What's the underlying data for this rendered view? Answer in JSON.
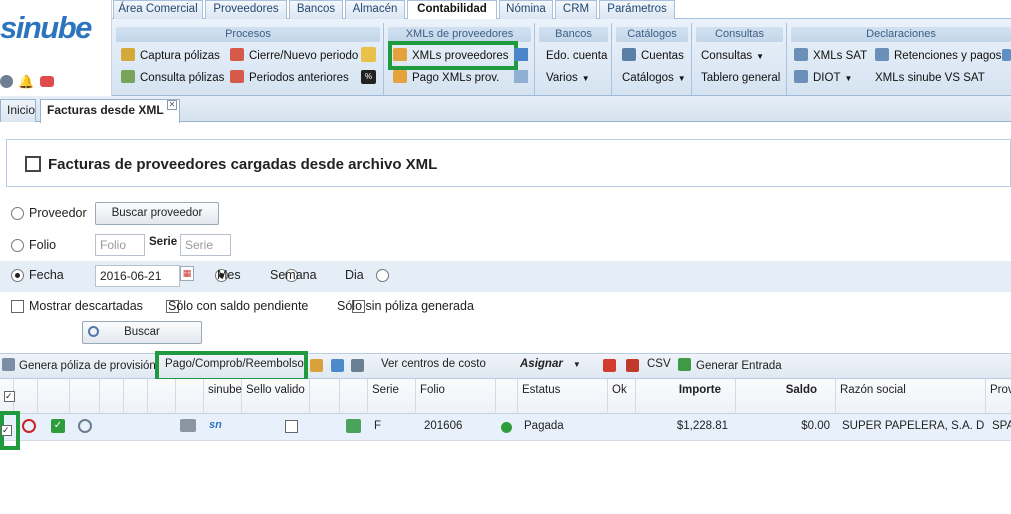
{
  "app": {
    "logo": "sinube"
  },
  "module_tabs": [
    "Área Comercial",
    "Proveedores",
    "Bancos",
    "Almacén",
    "Contabilidad",
    "Nómina",
    "CRM",
    "Parámetros"
  ],
  "active_module": "Contabilidad",
  "ribbon": {
    "procesos": {
      "title": "Procesos",
      "captura": "Captura pólizas",
      "consulta": "Consulta pólizas",
      "cierre": "Cierre/Nuevo periodo",
      "periodos": "Periodos anteriores"
    },
    "xmls": {
      "title": "XMLs de proveedores",
      "xmls_prov": "XMLs proveedores",
      "pago": "Pago XMLs prov."
    },
    "bancos": {
      "title": "Bancos",
      "edo": "Edo. cuenta",
      "varios": "Varios"
    },
    "catalogos": {
      "title": "Catálogos",
      "cuentas": "Cuentas",
      "catalogos": "Catálogos"
    },
    "consultas": {
      "title": "Consultas",
      "consultas": "Consultas",
      "tablero": "Tablero general"
    },
    "declaraciones": {
      "title": "Declaraciones",
      "xmls_sat": "XMLs SAT",
      "retenciones": "Retenciones y pagos",
      "diot": "DIOT",
      "xmls_vs": "XMLs sinube VS SAT"
    }
  },
  "doc_tabs": {
    "inicio": "Inicio",
    "facturas": "Facturas desde XML"
  },
  "panel": {
    "title": "Facturas de proveedores cargadas desde archivo XML"
  },
  "filters": {
    "proveedor": "Proveedor",
    "buscar_proveedor": "Buscar proveedor",
    "folio": "Folio",
    "folio_placeholder": "Folio",
    "serie": "Serie",
    "serie_placeholder": "Serie",
    "fecha": "Fecha",
    "fecha_value": "2016-06-21",
    "mes": "Mes",
    "semana": "Semana",
    "dia": "Dia",
    "mostrar_descartadas": "Mostrar descartadas",
    "saldo_pendiente": "Sólo con saldo pendiente",
    "sin_poliza": "Sólo sin póliza generada",
    "buscar": "Buscar"
  },
  "toolbar": {
    "genera_poliza": "Genera póliza de provisión",
    "pago": "Pago/Comprob/Reembolso",
    "centros": "Ver centros de costo",
    "asignar": "Asignar",
    "csv": "CSV",
    "generar_entrada": "Generar Entrada"
  },
  "table": {
    "headers": {
      "sinube": "sinube",
      "sello": "Sello valido",
      "serie": "Serie",
      "folio": "Folio",
      "estatus": "Estatus",
      "ok": "Ok",
      "importe": "Importe",
      "saldo": "Saldo",
      "razon": "Razón social",
      "prov": "Prov"
    },
    "rows": [
      {
        "serie": "F",
        "folio": "201606",
        "estatus": "Pagada",
        "importe": "$1,228.81",
        "saldo": "$0.00",
        "razon": "SUPER PAPELERA, S.A. D...",
        "prov": "SPA"
      }
    ]
  },
  "colors": {
    "accent": "#2d74bf",
    "highlight": "#1f9a3f",
    "status_ok": "#2e9e3c"
  }
}
